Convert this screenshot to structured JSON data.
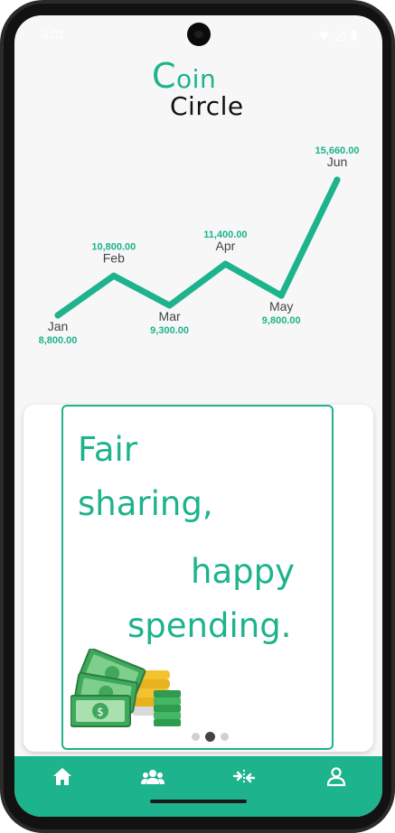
{
  "status": {
    "time": "3:01"
  },
  "app": {
    "logo_first": "C",
    "logo_rest": "oin",
    "logo_second": "Circle"
  },
  "chart_data": {
    "type": "line",
    "categories": [
      "Jan",
      "Feb",
      "Mar",
      "Apr",
      "May",
      "Jun"
    ],
    "values": [
      8800,
      10800,
      9300,
      11400,
      9800,
      15660
    ],
    "value_labels": [
      "8,800.00",
      "10,800.00",
      "9,300.00",
      "11,400.00",
      "9,800.00",
      "15,660.00"
    ],
    "title": "",
    "xlabel": "",
    "ylabel": "",
    "color": "#1db38c",
    "grid": false,
    "legend": "none"
  },
  "banner": {
    "line1": "Fair",
    "line2": "sharing,",
    "line3": "happy",
    "line4": "spending.",
    "slides": 3,
    "active_slide": 2
  },
  "nav": {
    "items": [
      {
        "name": "home",
        "icon": "home-icon"
      },
      {
        "name": "groups",
        "icon": "groups-icon"
      },
      {
        "name": "transfers",
        "icon": "compare-arrows-icon"
      },
      {
        "name": "profile",
        "icon": "person-icon"
      }
    ]
  },
  "colors": {
    "accent": "#1db38c",
    "text": "#444444"
  }
}
